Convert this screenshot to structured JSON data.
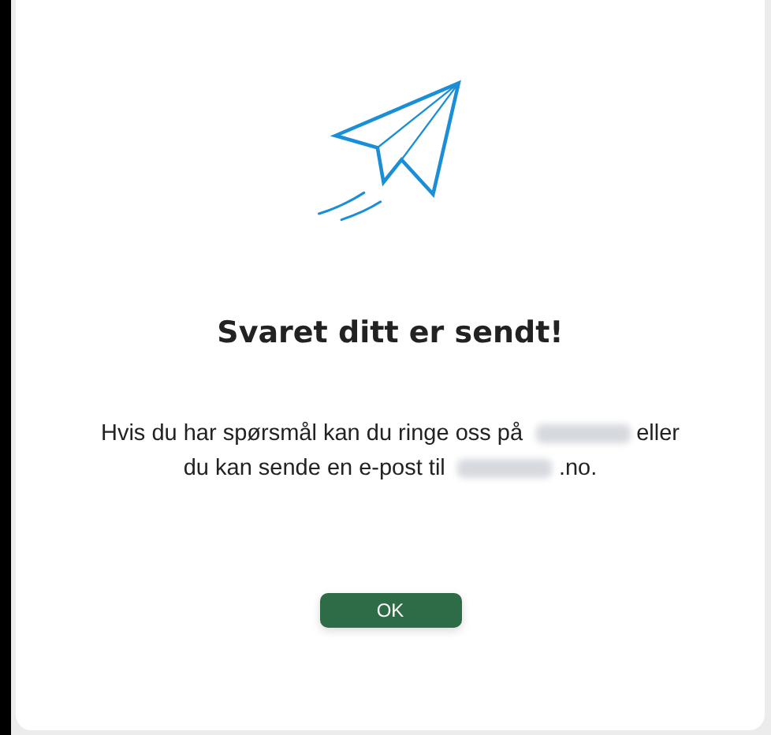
{
  "dialog": {
    "title": "Svaret ditt er sendt!",
    "message": [
      {
        "kind": "text",
        "text": "Hvis du har spørsmål kan du ringe oss på"
      },
      {
        "kind": "redacted"
      },
      {
        "kind": "text",
        "text": "eller"
      },
      {
        "kind": "break"
      },
      {
        "kind": "text",
        "text": "du kan sende en e-post til"
      },
      {
        "kind": "redacted"
      },
      {
        "kind": "tail",
        "text": ".no."
      }
    ],
    "button": "OK"
  }
}
